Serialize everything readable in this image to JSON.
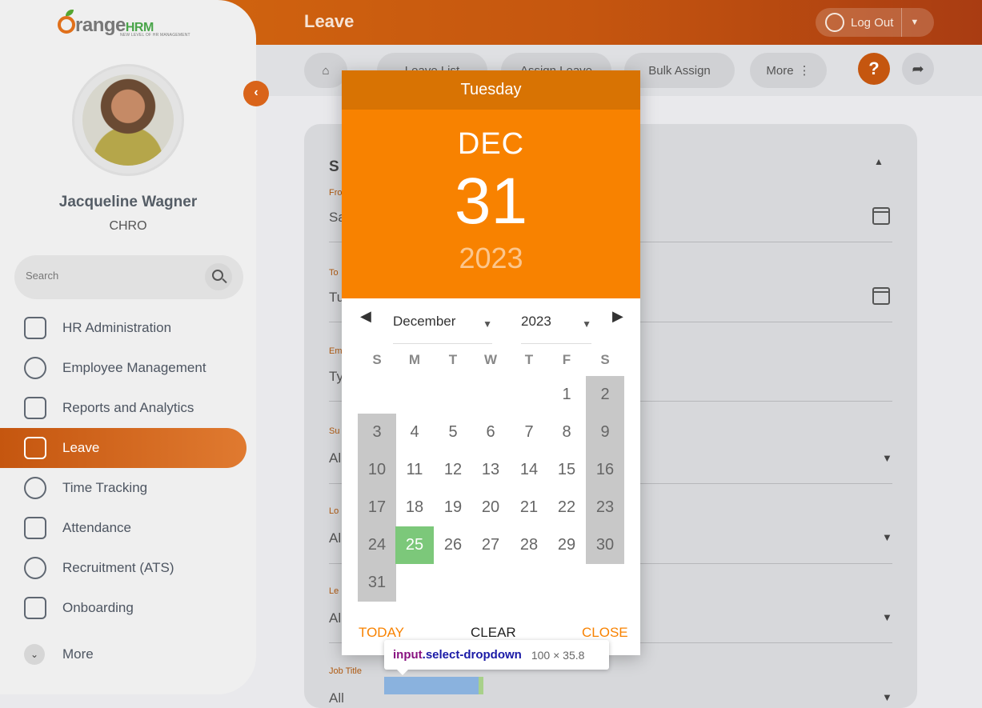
{
  "header": {
    "title": "Leave",
    "logout_label": "Log Out"
  },
  "sidebar": {
    "user_name": "Jacqueline Wagner",
    "user_role": "CHRO",
    "search_placeholder": "Search",
    "items": [
      {
        "label": "HR Administration",
        "icon": "hr-admin-icon"
      },
      {
        "label": "Employee Management",
        "icon": "employees-icon"
      },
      {
        "label": "Reports and Analytics",
        "icon": "reports-icon"
      },
      {
        "label": "Leave",
        "icon": "leave-icon",
        "active": true
      },
      {
        "label": "Time Tracking",
        "icon": "time-icon"
      },
      {
        "label": "Attendance",
        "icon": "attendance-icon"
      },
      {
        "label": "Recruitment (ATS)",
        "icon": "recruitment-icon"
      },
      {
        "label": "Onboarding",
        "icon": "onboarding-icon"
      },
      {
        "label": "More",
        "icon": "chevron-down-icon"
      }
    ]
  },
  "toolbar": {
    "tabs": [
      "Leave List",
      "Assign Leave",
      "Bulk Assign",
      "More"
    ]
  },
  "filter_card": {
    "fields": [
      {
        "label": "Fro",
        "value": "Sa"
      },
      {
        "label": "To",
        "value": "Tu"
      },
      {
        "label": "Em",
        "value": "Ty"
      },
      {
        "label": "Su",
        "value": "Al"
      },
      {
        "label": "Lo",
        "value": "Al"
      },
      {
        "label": "Le",
        "value": "Al"
      },
      {
        "label": "Job Title",
        "value": "All"
      }
    ],
    "section_title": "S"
  },
  "datepicker": {
    "weekday": "Tuesday",
    "month_short": "DEC",
    "day": "31",
    "year": "2023",
    "month_select": "December",
    "year_select": "2023",
    "weekday_headers": [
      "S",
      "M",
      "T",
      "W",
      "T",
      "F",
      "S"
    ],
    "weeks": [
      [
        "",
        "",
        "",
        "",
        "",
        "1",
        "2"
      ],
      [
        "3",
        "4",
        "5",
        "6",
        "7",
        "8",
        "9"
      ],
      [
        "10",
        "11",
        "12",
        "13",
        "14",
        "15",
        "16"
      ],
      [
        "17",
        "18",
        "19",
        "20",
        "21",
        "22",
        "23"
      ],
      [
        "24",
        "25",
        "26",
        "27",
        "28",
        "29",
        "30"
      ],
      [
        "31",
        "",
        "",
        "",
        "",
        "",
        ""
      ]
    ],
    "highlighted_day": "25",
    "actions": {
      "today": "TODAY",
      "clear": "CLEAR",
      "close": "CLOSE"
    },
    "colors": {
      "header_dark": "#d87303",
      "header": "#f88200",
      "highlight": "#7cc87a",
      "weekend": "#c8c8c8"
    }
  },
  "devtools_tooltip": {
    "tag": "input",
    "class": ".select-dropdown",
    "size": "100 × 35.8"
  }
}
